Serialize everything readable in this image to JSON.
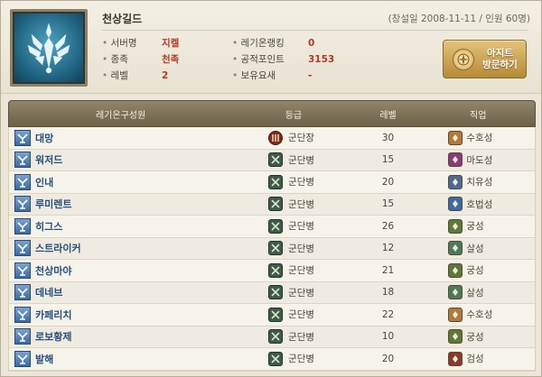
{
  "guild": {
    "name": "천상길드",
    "meta": "(창설일 2008-11-11 / 인원 60명)",
    "emblem_icon": "guild-emblem-icon"
  },
  "info_left": [
    {
      "label": "서버명",
      "value": "지켈"
    },
    {
      "label": "종족",
      "value": "천족"
    },
    {
      "label": "레벨",
      "value": "2"
    }
  ],
  "info_right": [
    {
      "label": "레기온랭킹",
      "value": "0"
    },
    {
      "label": "공적포인트",
      "value": "3153"
    },
    {
      "label": "보유요새",
      "value": "-"
    }
  ],
  "visit_button": {
    "line1": "아지트",
    "line2": "방문하기"
  },
  "table": {
    "headers": {
      "name": "레기온구성원",
      "grade": "등급",
      "level": "레벨",
      "job": "직업"
    },
    "rows": [
      {
        "name": "대망",
        "grade": "군단장",
        "grade_type": "leader",
        "level": "30",
        "job": "수호성",
        "job_color": "#b07a3c"
      },
      {
        "name": "워저드",
        "grade": "군단병",
        "grade_type": "member",
        "level": "15",
        "job": "마도성",
        "job_color": "#8a3a7a"
      },
      {
        "name": "인내",
        "grade": "군단병",
        "grade_type": "member",
        "level": "20",
        "job": "치유성",
        "job_color": "#4a6a9a"
      },
      {
        "name": "루미렌트",
        "grade": "군단병",
        "grade_type": "member",
        "level": "15",
        "job": "호법성",
        "job_color": "#3a6aa8"
      },
      {
        "name": "히그스",
        "grade": "군단병",
        "grade_type": "member",
        "level": "26",
        "job": "궁성",
        "job_color": "#5a7a3a"
      },
      {
        "name": "스트라이커",
        "grade": "군단병",
        "grade_type": "member",
        "level": "12",
        "job": "살성",
        "job_color": "#4a7a5a"
      },
      {
        "name": "천상마야",
        "grade": "군단병",
        "grade_type": "member",
        "level": "21",
        "job": "궁성",
        "job_color": "#5a7a3a"
      },
      {
        "name": "데네브",
        "grade": "군단병",
        "grade_type": "member",
        "level": "18",
        "job": "살성",
        "job_color": "#4a7a5a"
      },
      {
        "name": "카페리치",
        "grade": "군단병",
        "grade_type": "member",
        "level": "22",
        "job": "수호성",
        "job_color": "#b07a3c"
      },
      {
        "name": "로보황제",
        "grade": "군단병",
        "grade_type": "member",
        "level": "10",
        "job": "궁성",
        "job_color": "#5a7a3a"
      },
      {
        "name": "발해",
        "grade": "군단병",
        "grade_type": "member",
        "level": "20",
        "job": "검성",
        "job_color": "#8a3a2a"
      }
    ]
  }
}
